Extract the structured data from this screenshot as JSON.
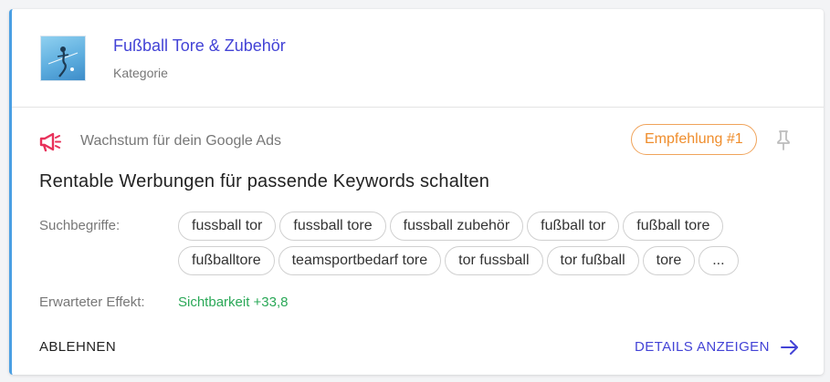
{
  "category": {
    "title": "Fußball Tore & Zubehör",
    "subtitle": "Kategorie",
    "thumbnail_icon": "football-goal-thumbnail"
  },
  "recommendation": {
    "category_label": "Wachstum für dein Google Ads",
    "category_icon": "megaphone-icon",
    "badge": "Empfehlung #1",
    "pin_icon": "pin-icon",
    "headline": "Rentable Werbungen für passende Keywords schalten",
    "search_terms_label": "Suchbegriffe:",
    "search_terms": [
      "fussball tor",
      "fussball tore",
      "fussball zubehör",
      "fußball tor",
      "fußball tore",
      "fußballtore",
      "teamsportbedarf tore",
      "tor fussball",
      "tor fußball",
      "tore",
      "..."
    ],
    "effect_label": "Erwarteter Effekt:",
    "effect_value": "Sichtbarkeit +33,8",
    "reject_label": "ABLEHNEN",
    "details_label": "DETAILS ANZEIGEN",
    "details_icon": "arrow-right-icon"
  },
  "colors": {
    "accent": "#4343d6",
    "left_border": "#4a9fe3",
    "badge": "#ef8d2c",
    "megaphone": "#e8315a",
    "effect_positive": "#2aa857"
  }
}
